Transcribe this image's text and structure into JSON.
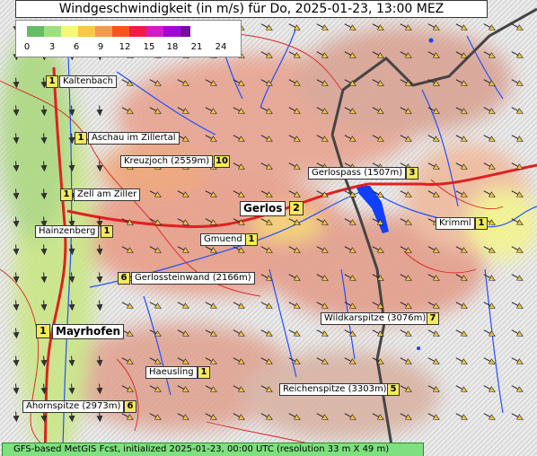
{
  "title": "Windgeschwindigkeit (in m/s) für Do, 2025-01-23, 13:00 MEZ",
  "legend": {
    "colors": [
      "#66bb66",
      "#9be07a",
      "#f6f67a",
      "#f6c94a",
      "#f59a4a",
      "#f4561c",
      "#f01c46",
      "#d01cc8",
      "#a00ad0",
      "#7a0aa0"
    ],
    "ticks": [
      "0",
      "3",
      "6",
      "9",
      "12",
      "15",
      "18",
      "21",
      "24"
    ]
  },
  "places": [
    {
      "id": "kaltenbach",
      "name": "Kaltenbach",
      "value": "1"
    },
    {
      "id": "aschau",
      "name": "Aschau im Zillertal",
      "value": "1"
    },
    {
      "id": "kreuzjoch",
      "name": "Kreuzjoch (2559m)",
      "value": "10"
    },
    {
      "id": "zell",
      "name": "Zell am Ziller",
      "value": "1"
    },
    {
      "id": "gerlospass",
      "name": "Gerlospass (1507m)",
      "value": "3"
    },
    {
      "id": "gerlos",
      "name": "Gerlos",
      "value": "2"
    },
    {
      "id": "krimml",
      "name": "Krimml",
      "value": "1"
    },
    {
      "id": "hainzenberg",
      "name": "Hainzenberg",
      "value": "1"
    },
    {
      "id": "gmuend",
      "name": "Gmuend",
      "value": "1"
    },
    {
      "id": "gerlossteinwand",
      "name": "Gerlossteinwand (2166m)",
      "value": "6"
    },
    {
      "id": "wildkarspitze",
      "name": "Wildkarspitze (3076m)",
      "value": "7"
    },
    {
      "id": "mayrhofen",
      "name": "Mayrhofen",
      "value": "1"
    },
    {
      "id": "haeusling",
      "name": "Haeusling",
      "value": "1"
    },
    {
      "id": "reichenspitze",
      "name": "Reichenspitze (3303m)",
      "value": "5"
    },
    {
      "id": "ahornspitze",
      "name": "Ahornspitze (2973m)",
      "value": "6"
    }
  ],
  "footer": "GFS-based MetGIS Fcst, initialized 2025-01-23, 00:00 UTC  (resolution 33 m X 49 m)"
}
